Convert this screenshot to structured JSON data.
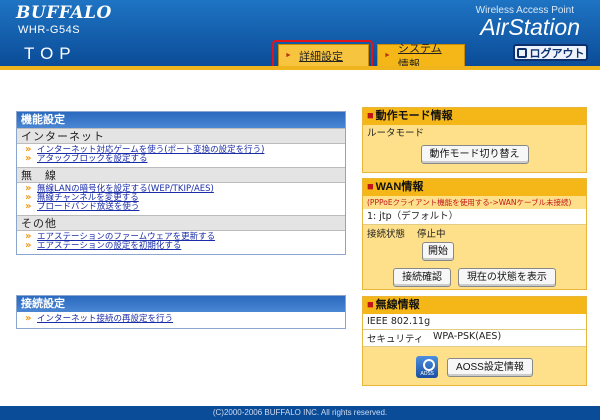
{
  "header": {
    "brand": "BUFFALO",
    "model": "WHR-G54S",
    "page_title": "TOP",
    "wap_label": "Wireless Access Point",
    "product": "AirStation",
    "tabs": [
      {
        "label": "詳細設定"
      },
      {
        "label": "システム情報"
      }
    ],
    "logout_label": "ログアウト"
  },
  "function_settings": {
    "title": "機能設定",
    "sections": [
      {
        "heading": "インターネット",
        "links": [
          "インターネット対応ゲームを使う(ポート変換の設定を行う)",
          "アタックブロックを設定する"
        ]
      },
      {
        "heading": "無　線",
        "links": [
          "無線LANの暗号化を設定する(WEP/TKIP/AES)",
          "無線チャンネルを変更する",
          "ブロードバンド放送を使う"
        ]
      },
      {
        "heading": "その他",
        "links": [
          "エアステーションのファームウェアを更新する",
          "エアステーションの設定を初期化する"
        ]
      }
    ]
  },
  "connection_settings": {
    "title": "接続設定",
    "links": [
      "インターネット接続の再設定を行う"
    ]
  },
  "mode_info": {
    "title": "動作モード情報",
    "mode": "ルータモード",
    "button": "動作モード切り替え"
  },
  "wan_info": {
    "title": "WAN情報",
    "note": "(PPPoEクライアント機能を使用する->WANケーブル未接続)",
    "session": "1: jtp（デフォルト）",
    "status_label": "接続状態",
    "status_value": "停止中",
    "start_button": "開始",
    "check_button": "接続確認",
    "show_status_button": "現在の状態を表示"
  },
  "wireless_info": {
    "title": "無線情報",
    "standard": "IEEE 802.11g",
    "security_label": "セキュリティ",
    "security_value": "WPA-PSK(AES)",
    "aoss_icon_label": "AOSS",
    "aoss_button": "AOSS設定情報"
  },
  "footer": {
    "copyright": "(C)2000-2006 BUFFALO INC. All rights reserved."
  },
  "colors": {
    "header_blue": "#0b4c98",
    "accent_gold": "#f5b617",
    "highlight_red": "#e0141b",
    "link_blue": "#1a2ca8"
  }
}
